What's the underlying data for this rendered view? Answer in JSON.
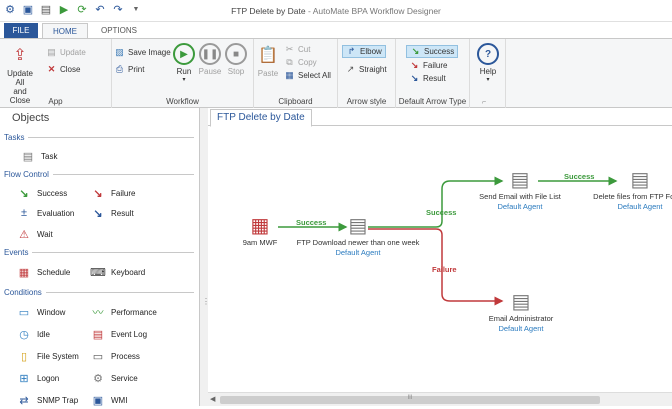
{
  "window": {
    "title": "FTP Delete by Date",
    "app_name": "AutoMate BPA Workflow Designer",
    "title_sep": " - "
  },
  "tabs": {
    "file": "FILE",
    "home": "HOME",
    "options": "OPTIONS"
  },
  "ribbon": {
    "app": {
      "update_all": "Update All",
      "update_all_2": "and Close",
      "update": "Update",
      "close": "Close",
      "group": "App"
    },
    "workflow": {
      "save_image": "Save Image",
      "print": "Print",
      "run": "Run",
      "pause": "Pause",
      "stop": "Stop",
      "group": "Workflow"
    },
    "clipboard": {
      "paste": "Paste",
      "cut": "Cut",
      "copy": "Copy",
      "select_all": "Select All",
      "group": "Clipboard"
    },
    "arrow_style": {
      "elbow": "Elbow",
      "straight": "Straight",
      "group": "Arrow style"
    },
    "arrow_type": {
      "success": "Success",
      "failure": "Failure",
      "result": "Result",
      "group": "Default Arrow Type"
    },
    "help": {
      "label": "Help"
    }
  },
  "objects": {
    "title": "Objects",
    "sections": {
      "tasks": "Tasks",
      "flow": "Flow Control",
      "events": "Events",
      "conditions": "Conditions"
    },
    "items": {
      "task": "Task",
      "success": "Success",
      "failure": "Failure",
      "evaluation": "Evaluation",
      "result": "Result",
      "wait": "Wait",
      "schedule": "Schedule",
      "keyboard": "Keyboard",
      "window": "Window",
      "performance": "Performance",
      "idle": "Idle",
      "event_log": "Event Log",
      "file_system": "File System",
      "process": "Process",
      "logon": "Logon",
      "service": "Service",
      "snmp_trap": "SNMP Trap",
      "wmi": "WMI"
    }
  },
  "document": {
    "tab": "FTP Delete by Date",
    "scroll_mark": "III"
  },
  "workflow": {
    "trigger": "9am MWF",
    "ftp_download": "FTP Download newer than one week",
    "send_email": "Send Email with File List",
    "delete_files": "Delete files from FTP Folder",
    "email_admin": "Email Administrator",
    "agent": "Default Agent",
    "success": "Success",
    "failure": "Failure"
  },
  "colors": {
    "accent": "#2b579a",
    "success": "#3c9a3c",
    "failure": "#c0393b",
    "agent": "#2b7bbf"
  }
}
